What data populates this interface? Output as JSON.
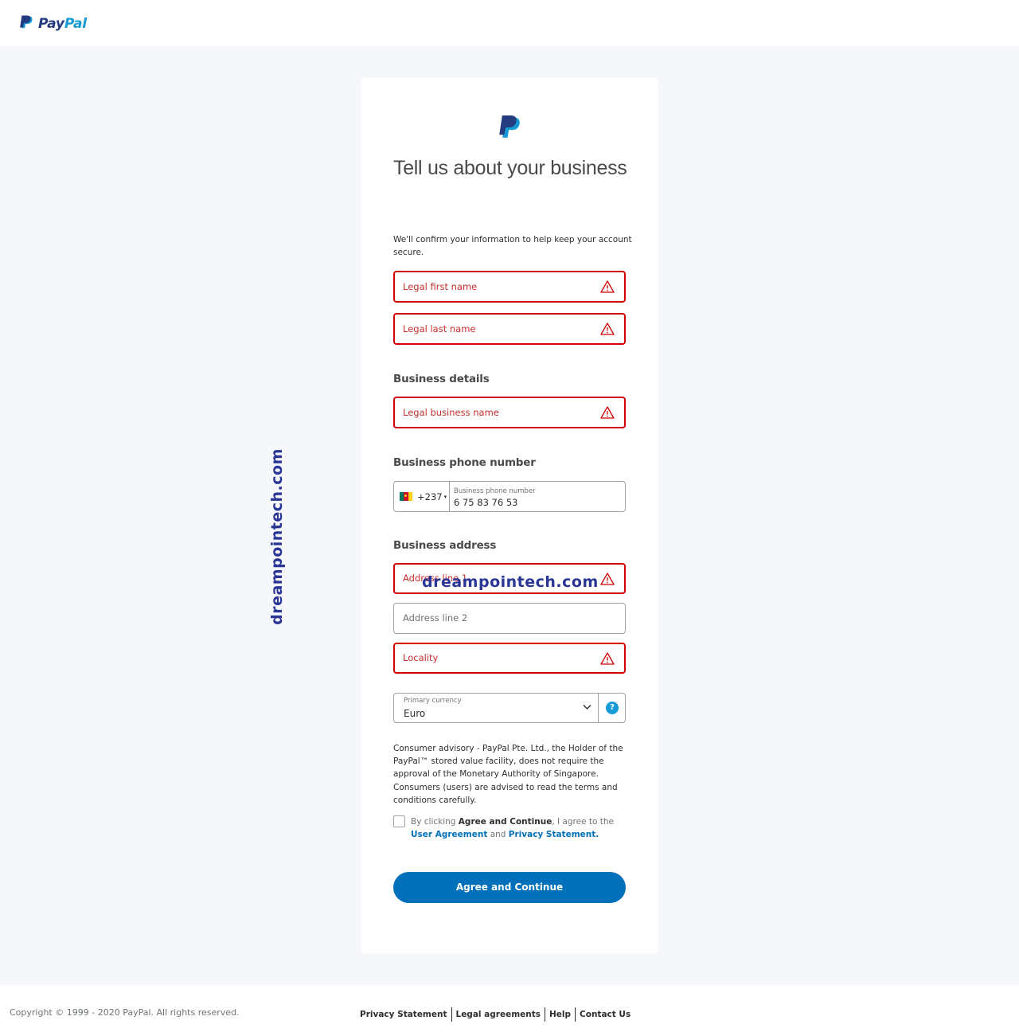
{
  "header": {
    "brand_pay": "Pay",
    "brand_pal": "Pal"
  },
  "form": {
    "title": "Tell us about your business",
    "subtitle": "We'll confirm your information to help keep your account secure.",
    "first_name_placeholder": "Legal first name",
    "last_name_placeholder": "Legal last name",
    "business_details_heading": "Business details",
    "business_name_placeholder": "Legal business name",
    "phone_heading": "Business phone number",
    "phone": {
      "country_code": "+237",
      "label": "Business phone number",
      "value": "6 75 83 76 53"
    },
    "address_heading": "Business address",
    "address_line1_placeholder": "Address line 1",
    "address_line2_placeholder": "Address line 2",
    "locality_placeholder": "Locality",
    "currency": {
      "label": "Primary currency",
      "value": "Euro",
      "help": "?"
    },
    "advisory": "Consumer advisory - PayPal Pte. Ltd., the Holder of the PayPal™ stored value facility, does not require the approval of the Monetary Authority of Singapore. Consumers (users) are advised to read the terms and conditions carefully.",
    "consent": {
      "prefix": "By clicking ",
      "bold": "Agree and Continue",
      "middle": ", I agree to the",
      "user_agreement": "User Agreement",
      "and": " and ",
      "privacy_statement": "Privacy Statement",
      "end": "."
    },
    "submit_label": "Agree and Continue"
  },
  "watermark": "dreampointech.com",
  "footer": {
    "copyright": "Copyright © 1999 - 2020 PayPal. All rights reserved.",
    "links": [
      "Privacy Statement",
      "Legal agreements",
      "Help",
      "Contact Us"
    ]
  },
  "colors": {
    "error": "#d20000",
    "primary": "#0070ba",
    "brand_dark": "#253b80",
    "brand_light": "#179bd7",
    "watermark": "#2a3696"
  }
}
